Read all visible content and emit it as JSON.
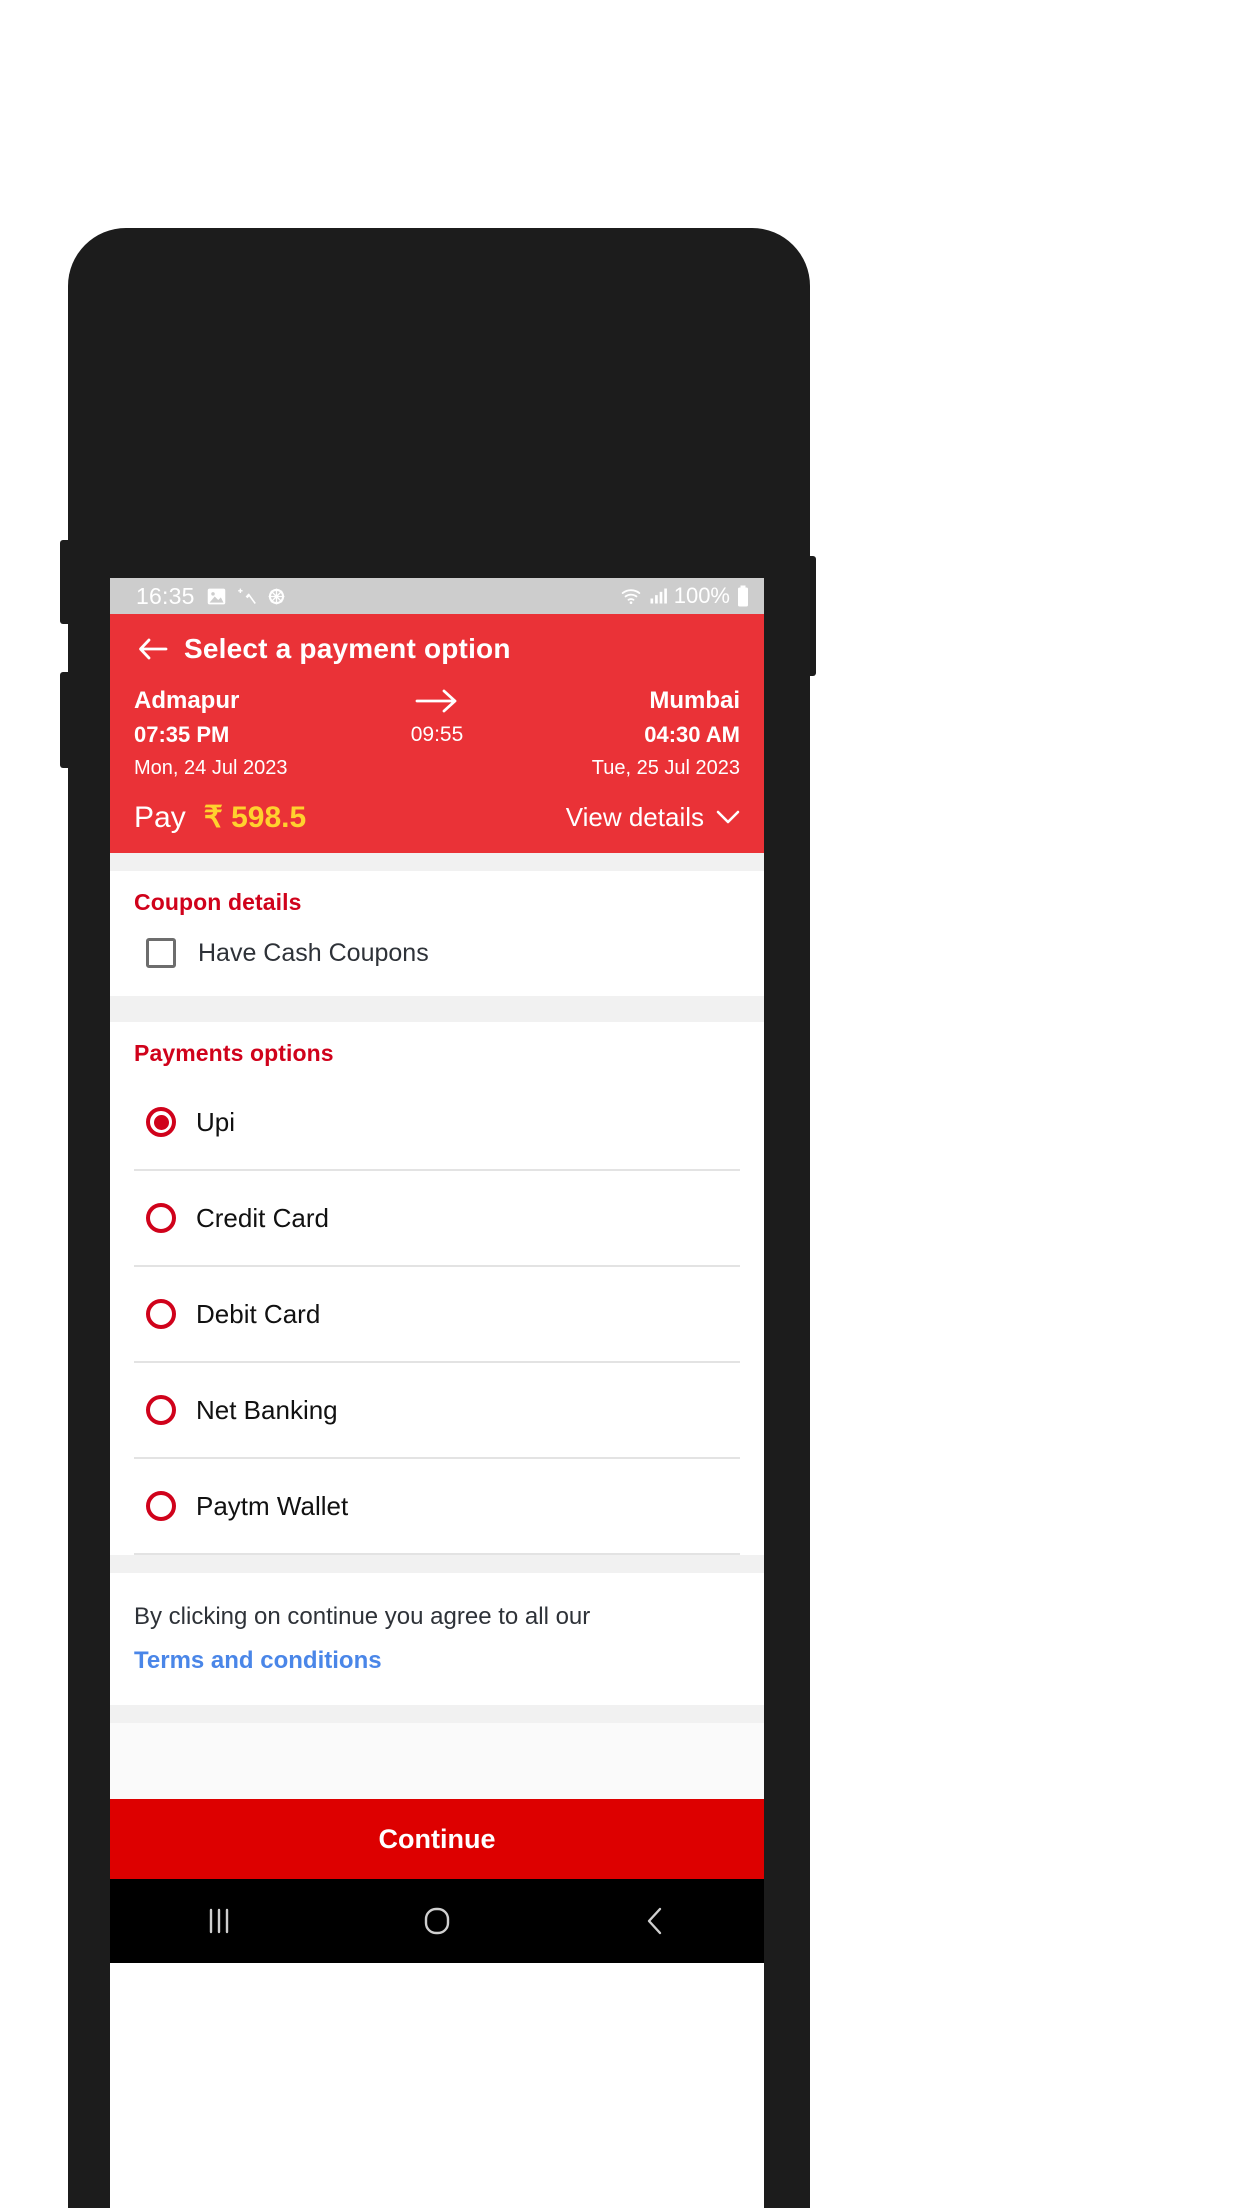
{
  "status_bar": {
    "time": "16:35",
    "battery_percent": "100%",
    "icons": [
      "photo-icon",
      "magic-wand-icon",
      "gear-icon",
      "wifi-icon",
      "signal-icon",
      "battery-icon"
    ]
  },
  "header": {
    "back_icon": "back-arrow-icon",
    "title": "Select a payment option",
    "origin_city": "Admapur",
    "origin_time": "07:35 PM",
    "origin_date": "Mon, 24 Jul 2023",
    "arrow_icon": "right-arrow-icon",
    "duration": "09:55",
    "destination_city": "Mumbai",
    "destination_time": "04:30 AM",
    "destination_date": "Tue, 25 Jul 2023",
    "pay_label": "Pay",
    "pay_amount": "₹ 598.5",
    "view_details_label": "View details",
    "view_details_icon": "chevron-down-icon",
    "bg_color": "#ea3237",
    "amount_color": "#ffd12e"
  },
  "coupon": {
    "section_title": "Coupon details",
    "checkbox_label": "Have Cash Coupons",
    "checked": false
  },
  "payments": {
    "section_title": "Payments options",
    "accent_color": "#d0021b",
    "options": [
      {
        "label": "Upi",
        "selected": true
      },
      {
        "label": "Credit Card",
        "selected": false
      },
      {
        "label": "Debit Card",
        "selected": false
      },
      {
        "label": "Net Banking",
        "selected": false
      },
      {
        "label": "Paytm Wallet",
        "selected": false
      }
    ]
  },
  "terms": {
    "text": "By clicking on continue you agree to all our",
    "link": "Terms and conditions",
    "link_color": "#4a86e8"
  },
  "footer": {
    "continue_label": "Continue",
    "continue_color": "#dd0000"
  },
  "navigation_bar": {
    "recents_icon": "recents-icon",
    "home_icon": "home-icon",
    "back_icon": "back-chevron-icon"
  }
}
